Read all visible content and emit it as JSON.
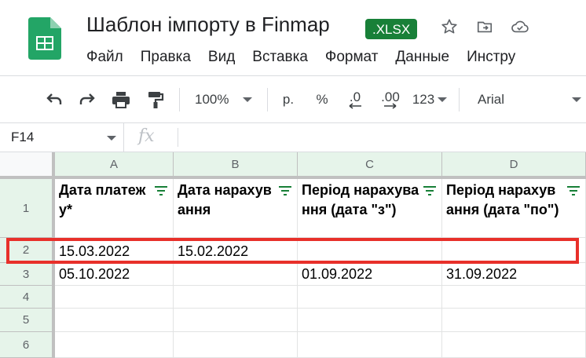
{
  "doc": {
    "title": "Шаблон імпорту в Finmap",
    "format_badge": ".XLSX"
  },
  "menu": [
    "Файл",
    "Правка",
    "Вид",
    "Вставка",
    "Формат",
    "Данные",
    "Инстру"
  ],
  "toolbar": {
    "zoom": "100%",
    "currency": "р.",
    "percent": "%",
    "decrease_decimals": ".0",
    "increase_decimals": ".00",
    "more_formats": "123",
    "font": "Arial"
  },
  "formula_bar": {
    "cell_ref": "F14",
    "fx_label": "fx",
    "value": ""
  },
  "sheet": {
    "columns": [
      "A",
      "B",
      "C",
      "D"
    ],
    "rows": [
      "1",
      "2",
      "3",
      "4",
      "5",
      "6"
    ],
    "header_row": [
      "Дата платежу*",
      "Дата нарахування",
      "Період нарахування (дата \"з\")",
      "Період нарахування (дата \"по\")"
    ],
    "data_rows": [
      [
        "15.03.2022",
        "15.02.2022",
        "",
        ""
      ],
      [
        "05.10.2022",
        "",
        "01.09.2022",
        "31.09.2022"
      ],
      [
        "",
        "",
        "",
        ""
      ],
      [
        "",
        "",
        "",
        ""
      ],
      [
        "",
        "",
        "",
        ""
      ]
    ]
  },
  "colors": {
    "brand_green": "#188038",
    "header_tint": "#e6f4ea",
    "highlight_red": "#e8302a"
  }
}
